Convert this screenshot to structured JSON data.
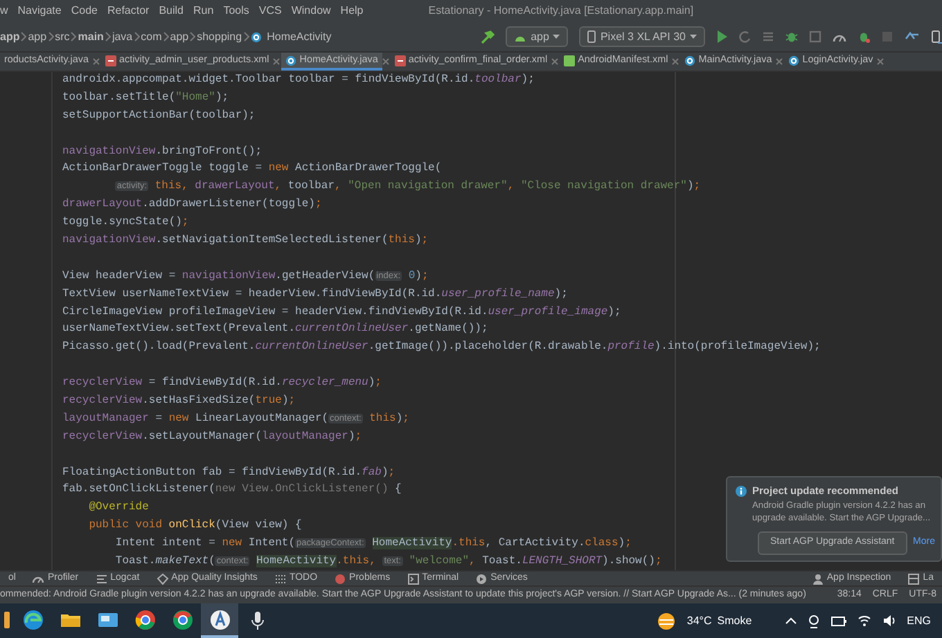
{
  "window": {
    "title": "Estationary - HomeActivity.java [Estationary.app.main]"
  },
  "menu": [
    "w",
    "Navigate",
    "Code",
    "Refactor",
    "Build",
    "Run",
    "Tools",
    "VCS",
    "Window",
    "Help"
  ],
  "breadcrumb": [
    {
      "label": "app",
      "kind": "module"
    },
    {
      "label": "app",
      "kind": "folder"
    },
    {
      "label": "src",
      "kind": "folder"
    },
    {
      "label": "main",
      "kind": "module"
    },
    {
      "label": "java",
      "kind": "folder"
    },
    {
      "label": "com",
      "kind": "folder"
    },
    {
      "label": "app",
      "kind": "folder"
    },
    {
      "label": "shopping",
      "kind": "folder"
    },
    {
      "label": "HomeActivity",
      "kind": "class"
    }
  ],
  "toolbar": {
    "configuration": "app",
    "device": "Pixel 3 XL API 30"
  },
  "tabs": [
    {
      "label": "roductsActivity.java",
      "kind": "none",
      "selected": false
    },
    {
      "label": "activity_admin_user_products.xml",
      "kind": "xml",
      "selected": false
    },
    {
      "label": "HomeActivity.java",
      "kind": "java",
      "selected": true
    },
    {
      "label": "activity_confirm_final_order.xml",
      "kind": "xml",
      "selected": false
    },
    {
      "label": "AndroidManifest.xml",
      "kind": "manifest",
      "selected": false
    },
    {
      "label": "MainActivity.java",
      "kind": "java",
      "selected": false
    },
    {
      "label": "LoginActivity.jav",
      "kind": "java",
      "selected": false
    }
  ],
  "editor": {
    "lines": [
      {
        "kind": "code",
        "parts": [
          {
            "kind": "t",
            "text": "androidx.appcompat.widget.Toolbar toolbar = findViewById(R.id."
          },
          {
            "kind": "sfld",
            "text": "toolbar"
          },
          {
            "kind": "t",
            "text": ");"
          }
        ]
      },
      {
        "kind": "code",
        "parts": [
          {
            "kind": "t",
            "text": "toolbar.setTitle("
          },
          {
            "kind": "str",
            "text": "\"Home\""
          },
          {
            "kind": "t",
            "text": ");"
          }
        ]
      },
      {
        "kind": "code",
        "parts": [
          {
            "kind": "t",
            "text": "setSupportActionBar(toolbar);"
          }
        ]
      },
      {
        "kind": "blank"
      },
      {
        "kind": "code",
        "parts": [
          {
            "kind": "fld",
            "text": "navigationView"
          },
          {
            "kind": "t",
            "text": ".bringToFront();"
          }
        ]
      },
      {
        "kind": "code",
        "parts": [
          {
            "kind": "t",
            "text": "ActionBarDrawerToggle toggle = "
          },
          {
            "kind": "kw",
            "text": "new "
          },
          {
            "kind": "t",
            "text": "ActionBarDrawerToggle("
          }
        ]
      },
      {
        "kind": "continuation",
        "parts": [
          {
            "kind": "hint",
            "text": "activity:"
          },
          {
            "kind": "kw",
            "text": "this, "
          },
          {
            "kind": "fld",
            "text": "drawerLayout"
          },
          {
            "kind": "kw",
            "text": ", "
          },
          {
            "kind": "t",
            "text": "toolbar"
          },
          {
            "kind": "kw",
            "text": ", "
          },
          {
            "kind": "str",
            "text": "\"Open navigation drawer\""
          },
          {
            "kind": "kw",
            "text": ", "
          },
          {
            "kind": "str",
            "text": "\"Close navigation drawer\""
          },
          {
            "kind": "t",
            "text": ")"
          },
          {
            "kind": "kw",
            "text": ";"
          }
        ]
      },
      {
        "kind": "code",
        "parts": [
          {
            "kind": "fld",
            "text": "drawerLayout"
          },
          {
            "kind": "t",
            "text": ".addDrawerListener(toggle)"
          },
          {
            "kind": "kw",
            "text": ";"
          }
        ]
      },
      {
        "kind": "code",
        "parts": [
          {
            "kind": "t",
            "text": "toggle.syncState()"
          },
          {
            "kind": "kw",
            "text": ";"
          }
        ]
      },
      {
        "kind": "code",
        "parts": [
          {
            "kind": "fld",
            "text": "navigationView"
          },
          {
            "kind": "t",
            "text": ".setNavigationItemSelectedListener("
          },
          {
            "kind": "kw",
            "text": "this"
          },
          {
            "kind": "t",
            "text": ")"
          },
          {
            "kind": "kw",
            "text": ";"
          }
        ]
      },
      {
        "kind": "blank"
      },
      {
        "kind": "code",
        "parts": [
          {
            "kind": "t",
            "text": "View headerView = "
          },
          {
            "kind": "fld",
            "text": "navigationView"
          },
          {
            "kind": "t",
            "text": ".getHeaderView("
          },
          {
            "kind": "hint",
            "text": "index:"
          },
          {
            "kind": "num",
            "text": "0"
          },
          {
            "kind": "t",
            "text": ")"
          },
          {
            "kind": "kw",
            "text": ";"
          }
        ]
      },
      {
        "kind": "code",
        "parts": [
          {
            "kind": "t",
            "text": "TextView userNameTextView = headerView.findViewById(R.id."
          },
          {
            "kind": "sfld",
            "text": "user_profile_name"
          },
          {
            "kind": "t",
            "text": ");"
          }
        ]
      },
      {
        "kind": "code",
        "parts": [
          {
            "kind": "t",
            "text": "CircleImageView profileImageView = headerView.findViewById(R.id."
          },
          {
            "kind": "sfld",
            "text": "user_profile_image"
          },
          {
            "kind": "t",
            "text": ");"
          }
        ]
      },
      {
        "kind": "code",
        "parts": [
          {
            "kind": "t",
            "text": "userNameTextView.setText(Prevalent."
          },
          {
            "kind": "sfld",
            "text": "currentOnlineUser"
          },
          {
            "kind": "t",
            "text": ".getName());"
          }
        ]
      },
      {
        "kind": "code",
        "parts": [
          {
            "kind": "t",
            "text": "Picasso.get().load(Prevalent."
          },
          {
            "kind": "sfld",
            "text": "currentOnlineUser"
          },
          {
            "kind": "t",
            "text": ".getImage()).placeholder(R.drawable."
          },
          {
            "kind": "sfld",
            "text": "profile"
          },
          {
            "kind": "t",
            "text": ").into(profileImageView);"
          }
        ]
      },
      {
        "kind": "blank"
      },
      {
        "kind": "code",
        "parts": [
          {
            "kind": "fld",
            "text": "recyclerView"
          },
          {
            "kind": "t",
            "text": " = findViewById(R.id."
          },
          {
            "kind": "sfld",
            "text": "recycler_menu"
          },
          {
            "kind": "t",
            "text": ")"
          },
          {
            "kind": "kw",
            "text": ";"
          }
        ]
      },
      {
        "kind": "code",
        "parts": [
          {
            "kind": "fld",
            "text": "recyclerView"
          },
          {
            "kind": "t",
            "text": ".setHasFixedSize("
          },
          {
            "kind": "kw",
            "text": "true"
          },
          {
            "kind": "t",
            "text": ")"
          },
          {
            "kind": "kw",
            "text": ";"
          }
        ]
      },
      {
        "kind": "code",
        "parts": [
          {
            "kind": "fld",
            "text": "layoutManager"
          },
          {
            "kind": "t",
            "text": " = "
          },
          {
            "kind": "kw",
            "text": "new "
          },
          {
            "kind": "t",
            "text": "LinearLayoutManager("
          },
          {
            "kind": "hint",
            "text": "context:"
          },
          {
            "kind": "kw",
            "text": "this"
          },
          {
            "kind": "t",
            "text": ")"
          },
          {
            "kind": "kw",
            "text": ";"
          }
        ]
      },
      {
        "kind": "code",
        "parts": [
          {
            "kind": "fld",
            "text": "recyclerView"
          },
          {
            "kind": "t",
            "text": ".setLayoutManager("
          },
          {
            "kind": "fld",
            "text": "layoutManager"
          },
          {
            "kind": "t",
            "text": ")"
          },
          {
            "kind": "kw",
            "text": ";"
          }
        ]
      },
      {
        "kind": "blank"
      },
      {
        "kind": "code",
        "parts": [
          {
            "kind": "t",
            "text": "FloatingActionButton fab = findViewById(R.id."
          },
          {
            "kind": "sfld",
            "text": "fab"
          },
          {
            "kind": "t",
            "text": ")"
          },
          {
            "kind": "kw",
            "text": ";"
          }
        ]
      },
      {
        "kind": "code",
        "parts": [
          {
            "kind": "t",
            "text": "fab.setOnClickListener("
          },
          {
            "kind": "dim",
            "text": "new View.OnClickListener()"
          },
          {
            "kind": "t",
            "text": " {"
          }
        ]
      },
      {
        "kind": "nested",
        "parts": [
          {
            "kind": "ann",
            "text": "@Override"
          }
        ]
      },
      {
        "kind": "nested",
        "parts": [
          {
            "kind": "kw",
            "text": "public void "
          },
          {
            "kind": "decl",
            "text": "onClick"
          },
          {
            "kind": "t",
            "text": "(View view) {"
          }
        ]
      },
      {
        "kind": "inner",
        "parts": [
          {
            "kind": "t",
            "text": "Intent intent = "
          },
          {
            "kind": "kw",
            "text": "new "
          },
          {
            "kind": "t",
            "text": "Intent("
          },
          {
            "kind": "hint",
            "text": "packageContext:"
          },
          {
            "kind": "hl",
            "text": "HomeActivity"
          },
          {
            "kind": "kw",
            "text": ".this"
          },
          {
            "kind": "t",
            "text": ", CartActivity."
          },
          {
            "kind": "kw",
            "text": "class"
          },
          {
            "kind": "t",
            "text": ")"
          },
          {
            "kind": "kw",
            "text": ";"
          }
        ]
      },
      {
        "kind": "inner",
        "parts": [
          {
            "kind": "t",
            "text": "Toast."
          },
          {
            "kind": "it",
            "text": "makeText"
          },
          {
            "kind": "t",
            "text": "("
          },
          {
            "kind": "hint",
            "text": "context:"
          },
          {
            "kind": "hl",
            "text": "HomeActivity"
          },
          {
            "kind": "kw",
            "text": ".this, "
          },
          {
            "kind": "hint",
            "text": "text:"
          },
          {
            "kind": "str",
            "text": "\"welcome\""
          },
          {
            "kind": "kw",
            "text": ", "
          },
          {
            "kind": "t",
            "text": "Toast."
          },
          {
            "kind": "sfld",
            "text": "LENGTH_SHORT"
          },
          {
            "kind": "t",
            "text": ").show()"
          },
          {
            "kind": "kw",
            "text": ";"
          }
        ]
      }
    ]
  },
  "notification": {
    "title": "Project update recommended",
    "body": "Android Gradle plugin version 4.2.2 has an upgrade available. Start the AGP Upgrade...",
    "button": "Start AGP Upgrade Assistant",
    "link": "More"
  },
  "tool_windows": [
    {
      "label": "ol",
      "kind": "none"
    },
    {
      "label": "Profiler",
      "kind": "gauge"
    },
    {
      "label": "Logcat",
      "kind": "lines"
    },
    {
      "label": "App Quality Insights",
      "kind": "diamond"
    },
    {
      "label": "TODO",
      "kind": "list"
    },
    {
      "label": "Problems",
      "kind": "error"
    },
    {
      "label": "Terminal",
      "kind": "terminal"
    },
    {
      "label": "Services",
      "kind": "play"
    }
  ],
  "tool_windows_right": [
    {
      "label": "App Inspection",
      "kind": "person"
    },
    {
      "label": "La",
      "kind": "layout"
    }
  ],
  "status_bar": {
    "message": "ommended: Android Gradle plugin version 4.2.2 has an upgrade available.  Start the AGP Upgrade Assistant to update this project's AGP version. // Start AGP Upgrade As... (2 minutes ago)",
    "position": "38:14",
    "line_separator": "CRLF",
    "encoding": "UTF-8"
  },
  "taskbar": {
    "apps": [
      {
        "kind": "partial",
        "selected": false
      },
      {
        "kind": "edge",
        "selected": false
      },
      {
        "kind": "folder",
        "selected": false
      },
      {
        "kind": "mail",
        "selected": false
      },
      {
        "kind": "chrome",
        "selected": false
      },
      {
        "kind": "chrome-alt",
        "selected": false
      },
      {
        "kind": "studio",
        "selected": true
      },
      {
        "kind": "mic",
        "selected": false
      }
    ],
    "weather": {
      "temperature": "34°C",
      "condition": "Smoke"
    },
    "language": "ENG"
  }
}
